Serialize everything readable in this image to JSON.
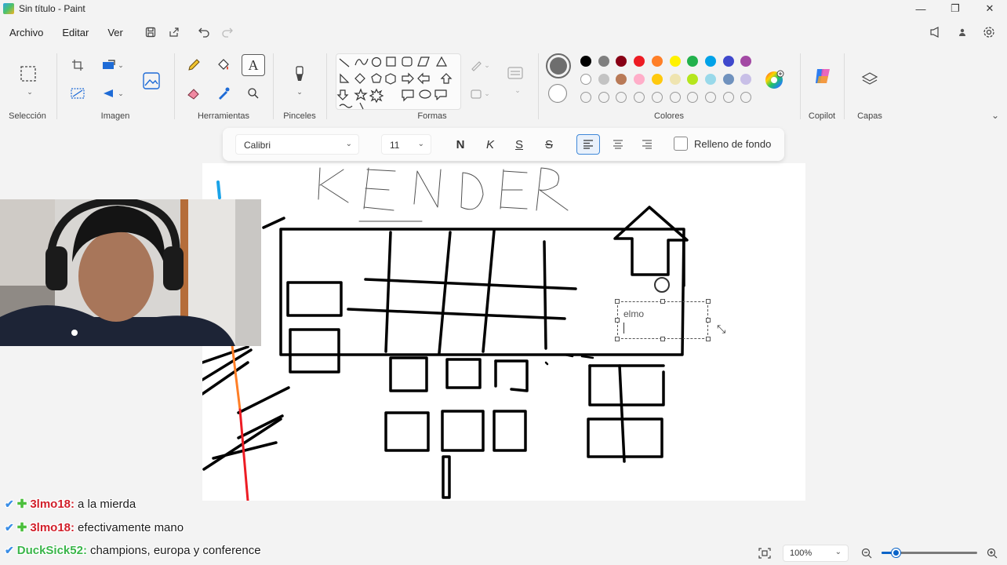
{
  "window": {
    "title": "Sin título - Paint",
    "minimize": "—",
    "restore": "❐",
    "close": "✕"
  },
  "menu": {
    "file": "Archivo",
    "edit": "Editar",
    "view": "Ver"
  },
  "ribbon": {
    "groups": {
      "selection": "Selección",
      "image": "Imagen",
      "tools": "Herramientas",
      "brushes": "Pinceles",
      "shapes": "Formas",
      "colors": "Colores",
      "copilot": "Copilot",
      "layers": "Capas"
    },
    "active_tool": "text-tool",
    "primary_color": "#6e6e6e",
    "secondary_color": "#ffffff",
    "palette_row1": [
      "#000000",
      "#7f7f7f",
      "#880015",
      "#ed1c24",
      "#ff7f27",
      "#fff200",
      "#22b14c",
      "#00a2e8",
      "#3f48cc",
      "#a349a4"
    ],
    "palette_row2": [
      "#ffffff",
      "#c3c3c3",
      "#b97a57",
      "#ffaec9",
      "#ffc90e",
      "#efe4b0",
      "#b5e61d",
      "#99d9ea",
      "#7092be",
      "#c8bfe7"
    ],
    "palette_row3_empty": 10
  },
  "textbar": {
    "font": "Calibri",
    "size": "11",
    "bold": "N",
    "italic": "K",
    "underline": "S",
    "strike": "S",
    "bg_fill_label": "Relleno de fondo",
    "bg_fill_checked": false
  },
  "canvas": {
    "textbox_text": "elmo"
  },
  "chat": [
    {
      "user": "3lmo18:",
      "message": "a la mierda",
      "user_color": "red"
    },
    {
      "user": "3lmo18:",
      "message": "efectivamente mano",
      "user_color": "red"
    },
    {
      "user": "DuckSick52:",
      "message": "champions, europa y conference",
      "user_color": "green"
    }
  ],
  "status": {
    "zoom": "100%",
    "zoom_level_percent": 100
  }
}
